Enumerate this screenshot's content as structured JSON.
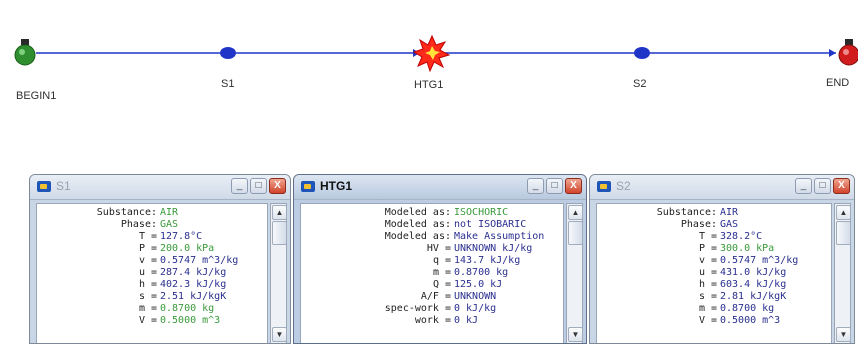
{
  "flow": {
    "nodes": [
      {
        "id": "begin",
        "label": "BEGIN1"
      },
      {
        "id": "s1",
        "label": "S1"
      },
      {
        "id": "htg1",
        "label": "HTG1"
      },
      {
        "id": "s2",
        "label": "S2"
      },
      {
        "id": "end",
        "label": "END"
      }
    ],
    "colors": {
      "line": "#1e35c8",
      "state_dot": "#1e35c8",
      "begin": "#2f8f2f",
      "end": "#d01c1c"
    }
  },
  "windows": [
    {
      "id": "s1",
      "title": "S1",
      "active": false,
      "rows": [
        {
          "label": "Substance:",
          "value": "AIR",
          "green": true
        },
        {
          "label": "Phase:",
          "value": "GAS",
          "green": true
        },
        {
          "label": "T =",
          "value": "127.8°C",
          "green": false
        },
        {
          "label": "P =",
          "value": "200.0 kPa",
          "green": true
        },
        {
          "label": "v =",
          "value": "0.5747 m^3/kg",
          "green": false
        },
        {
          "label": "u =",
          "value": "287.4 kJ/kg",
          "green": false
        },
        {
          "label": "h =",
          "value": "402.3 kJ/kg",
          "green": false
        },
        {
          "label": "s =",
          "value": "2.51 kJ/kgK",
          "green": false
        },
        {
          "label": "m =",
          "value": "0.8700 kg",
          "green": true
        },
        {
          "label": "V =",
          "value": "0.5000 m^3",
          "green": true
        }
      ]
    },
    {
      "id": "htg1",
      "title": "HTG1",
      "active": true,
      "rows": [
        {
          "label": "Modeled as:",
          "value": "ISOCHORIC",
          "green": true
        },
        {
          "label": "Modeled as:",
          "value": "not ISOBARIC",
          "green": false
        },
        {
          "label": "Modeled as:",
          "value": "Make Assumption",
          "green": false
        },
        {
          "label": "HV =",
          "value": "UNKNOWN kJ/kg",
          "green": false
        },
        {
          "label": "q =",
          "value": "143.7 kJ/kg",
          "green": false
        },
        {
          "label": "m =",
          "value": "0.8700 kg",
          "green": false
        },
        {
          "label": "Q =",
          "value": "125.0 kJ",
          "green": false
        },
        {
          "label": "A/F =",
          "value": "UNKNOWN",
          "green": false
        },
        {
          "label": "spec-work =",
          "value": "0 kJ/kg",
          "green": false
        },
        {
          "label": "work =",
          "value": "0 kJ",
          "green": false
        }
      ]
    },
    {
      "id": "s2",
      "title": "S2",
      "active": false,
      "rows": [
        {
          "label": "Substance:",
          "value": "AIR",
          "green": false
        },
        {
          "label": "Phase:",
          "value": "GAS",
          "green": false
        },
        {
          "label": "T =",
          "value": "328.2°C",
          "green": false
        },
        {
          "label": "P =",
          "value": "300.0 kPa",
          "green": true
        },
        {
          "label": "v =",
          "value": "0.5747 m^3/kg",
          "green": false
        },
        {
          "label": "u =",
          "value": "431.0 kJ/kg",
          "green": false
        },
        {
          "label": "h =",
          "value": "603.4 kJ/kg",
          "green": false
        },
        {
          "label": "s =",
          "value": "2.81 kJ/kgK",
          "green": false
        },
        {
          "label": "m =",
          "value": "0.8700 kg",
          "green": false
        },
        {
          "label": "V =",
          "value": "0.5000 m^3",
          "green": false
        }
      ]
    }
  ],
  "window_controls": {
    "minimize": "_",
    "maximize": "□",
    "close": "X",
    "scroll_up": "▲",
    "scroll_down": "▼"
  }
}
